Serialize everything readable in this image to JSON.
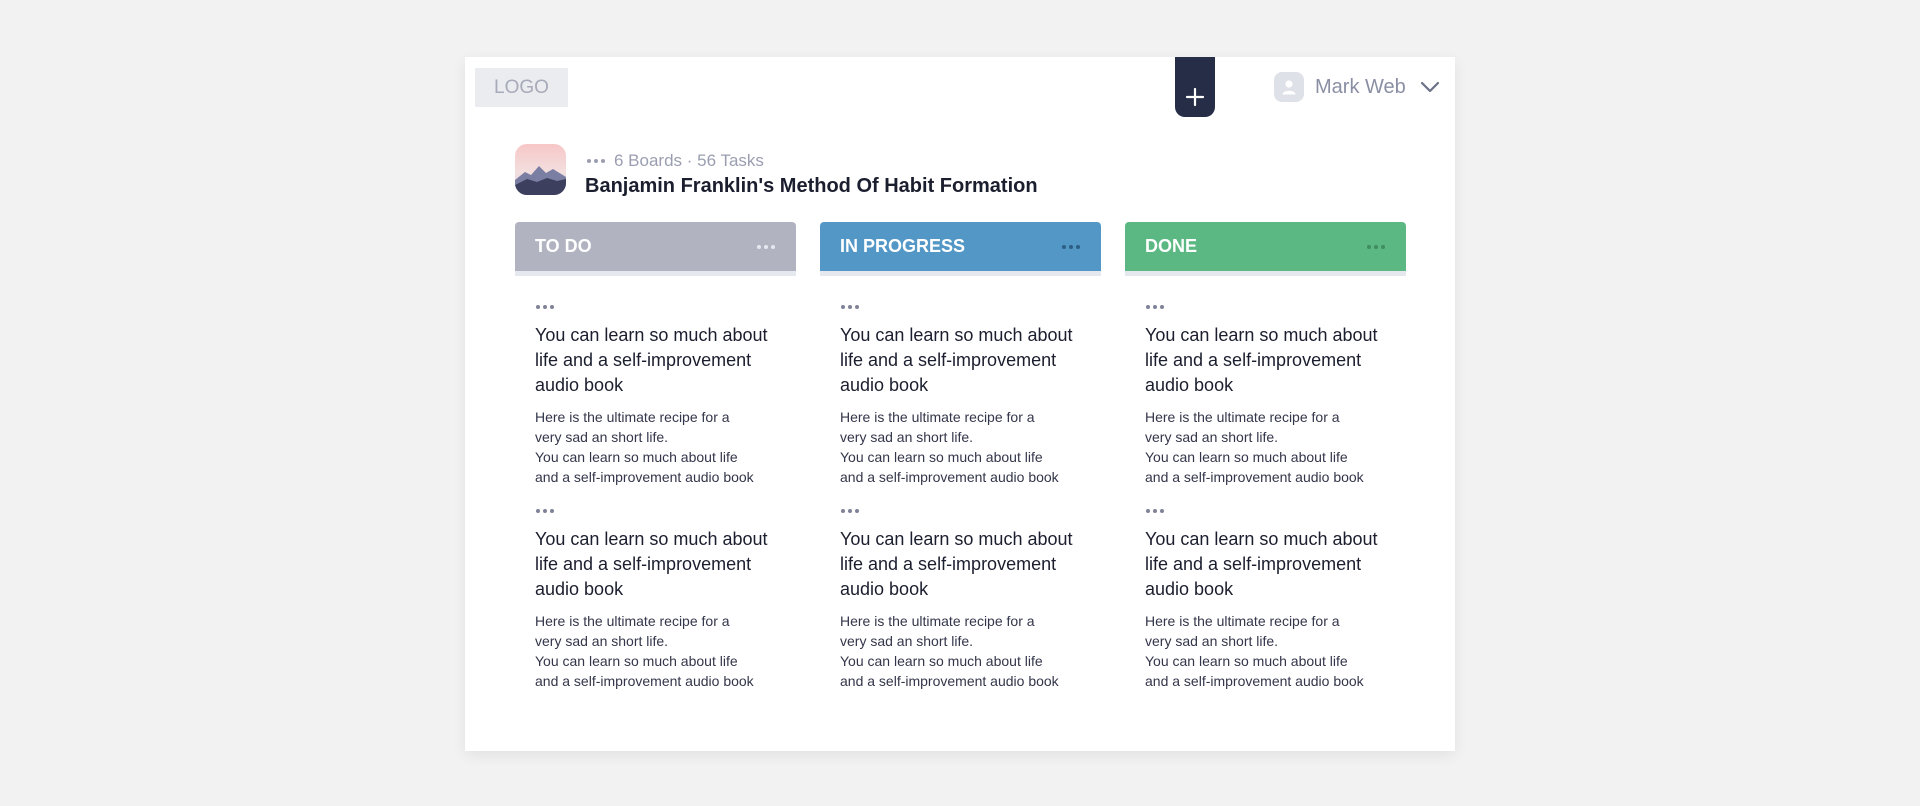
{
  "header": {
    "logo": "LOGO",
    "user_name": "Mark Web"
  },
  "board": {
    "meta": "6 Boards · 56 Tasks",
    "title": "Banjamin Franklin's Method Of Habit Formation"
  },
  "columns": [
    {
      "label": "TO DO",
      "color": "#b1b3c0",
      "tasks": [
        {
          "title": "You can learn so much about life and a self-improvement audio book",
          "desc": [
            "Here is the ultimate recipe for a",
            "very sad an short life.",
            "You can learn so much about life",
            "and a self-improvement audio book"
          ]
        },
        {
          "title": "You can learn so much about life and a self-improvement audio book",
          "desc": [
            "Here is the ultimate recipe for a",
            "very sad an short life.",
            "You can learn so much about life",
            "and a self-improvement audio book"
          ]
        }
      ]
    },
    {
      "label": "IN PROGRESS",
      "color": "#5297c5",
      "tasks": [
        {
          "title": "You can learn so much about life and a self-improvement audio book",
          "desc": [
            "Here is the ultimate recipe for a",
            "very sad an short life.",
            "You can learn so much about life",
            "and a self-improvement audio book"
          ]
        },
        {
          "title": "You can learn so much about life and a self-improvement audio book",
          "desc": [
            "Here is the ultimate recipe for a",
            "very sad an short life.",
            "You can learn so much about life",
            "and a self-improvement audio book"
          ]
        }
      ]
    },
    {
      "label": "DONE",
      "color": "#5cb883",
      "tasks": [
        {
          "title": "You can learn so much about life and a self-improvement audio book",
          "desc": [
            "Here is the ultimate recipe for a",
            "very sad an short life.",
            "You can learn so much about life",
            "and a self-improvement audio book"
          ]
        },
        {
          "title": "You can learn so much about life and a self-improvement audio book",
          "desc": [
            "Here is the ultimate recipe for a",
            "very sad an short life.",
            "You can learn so much about life",
            "and a self-improvement audio book"
          ]
        }
      ]
    }
  ],
  "icons": {
    "add": "plus-icon",
    "user": "user-avatar-icon",
    "dropdown": "chevron-down-icon",
    "menu": "more-dots-icon"
  }
}
